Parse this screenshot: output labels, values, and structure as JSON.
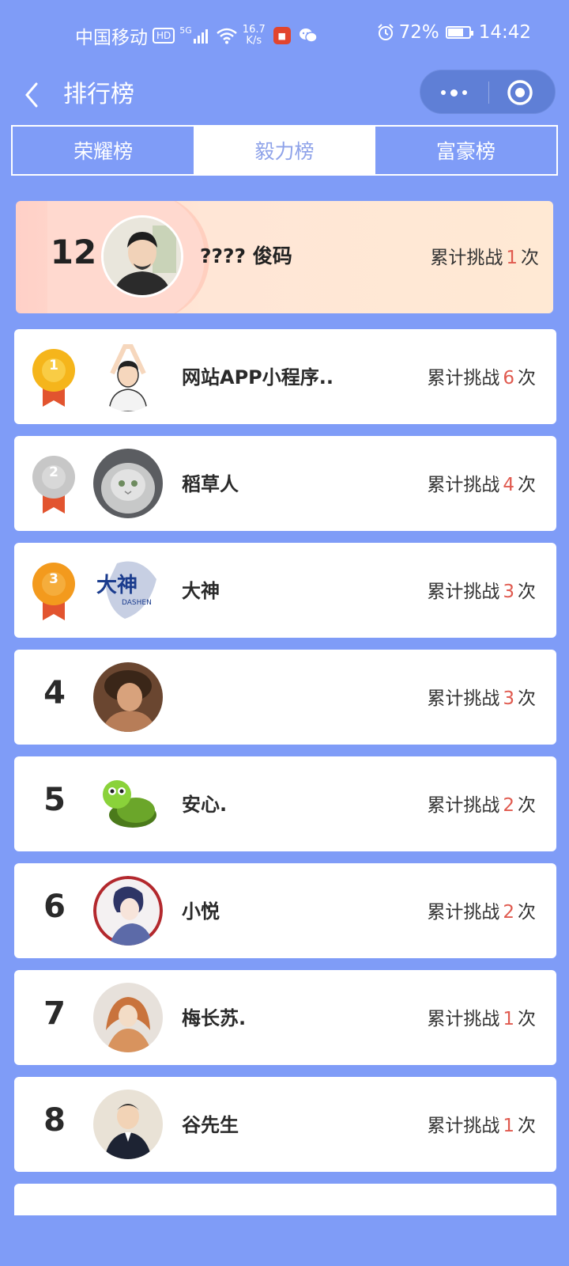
{
  "status_bar": {
    "carrier": "中国移动",
    "hd": "HD",
    "network": "5G",
    "speed_value": "16.7",
    "speed_unit": "K/s",
    "battery_percent": "72%",
    "battery_level": 0.72,
    "time": "14:42"
  },
  "nav": {
    "title": "排行榜"
  },
  "tabs": [
    {
      "label": "荣耀榜",
      "active": false
    },
    {
      "label": "毅力榜",
      "active": true
    },
    {
      "label": "富豪榜",
      "active": false
    }
  ],
  "my_rank": {
    "rank": "12",
    "name": "???? 俊码",
    "stat_prefix": "累计挑战",
    "count": "1",
    "stat_suffix": "次"
  },
  "stat_prefix": "累计挑战",
  "stat_suffix": "次",
  "rows": [
    {
      "rank": "1",
      "medal": "gold",
      "name": "网站APP小程序..",
      "count": "6"
    },
    {
      "rank": "2",
      "medal": "silver",
      "name": "稻草人",
      "count": "4"
    },
    {
      "rank": "3",
      "medal": "bronze",
      "name": "大神",
      "count": "3"
    },
    {
      "rank": "4",
      "medal": "",
      "name": "",
      "count": "3"
    },
    {
      "rank": "5",
      "medal": "",
      "name": "安心.",
      "count": "2"
    },
    {
      "rank": "6",
      "medal": "",
      "name": "小悦",
      "count": "2"
    },
    {
      "rank": "7",
      "medal": "",
      "name": "梅长苏.",
      "count": "1"
    },
    {
      "rank": "8",
      "medal": "",
      "name": "谷先生",
      "count": "1"
    }
  ],
  "colors": {
    "background": "#7f9cf7",
    "accent_count": "#e05a4f",
    "active_tab_text": "#8ea2e9",
    "gold": "#f5b51b",
    "silver": "#c7c7c7",
    "bronze": "#f39a1d",
    "ribbon": "#e2542f"
  },
  "icons": {
    "back": "chevron-left-icon",
    "more": "more-dots-icon",
    "close": "target-close-icon",
    "medal": "medal-icon"
  }
}
